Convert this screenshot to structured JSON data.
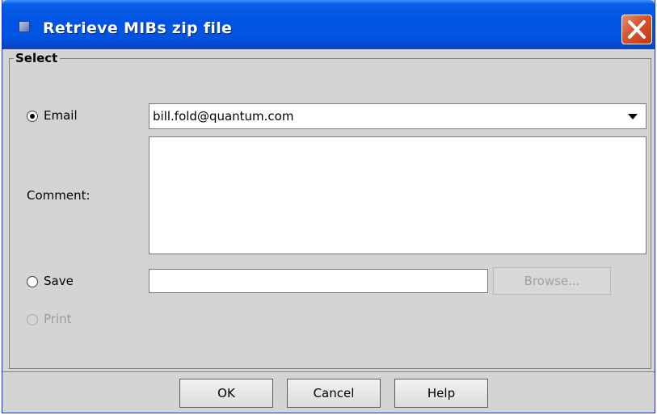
{
  "window": {
    "title": "Retrieve MIBs zip file"
  },
  "group": {
    "label": "Select"
  },
  "email": {
    "label": "Email",
    "selected": true,
    "value": "bill.fold@quantum.com"
  },
  "comment": {
    "label": "Comment:",
    "value": ""
  },
  "save": {
    "label": "Save",
    "selected": false,
    "path": "",
    "browse_label": "Browse..."
  },
  "print": {
    "label": "Print",
    "selected": false,
    "enabled": false
  },
  "buttons": {
    "ok": "OK",
    "cancel": "Cancel",
    "help": "Help"
  },
  "icons": {
    "window_icon": "app-window-icon",
    "close": "close-icon",
    "dropdown": "chevron-down-icon"
  },
  "colors": {
    "titlebar": "#0054e3",
    "close_button": "#d5532d",
    "dialog_background": "#d4d4d4"
  }
}
